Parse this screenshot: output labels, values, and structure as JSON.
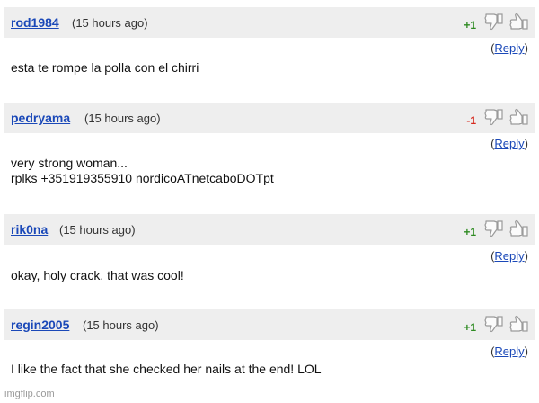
{
  "comments": [
    {
      "username": "rod1984",
      "time": "(15 hours ago)",
      "score": "+1",
      "reply_open": "(",
      "reply_label": "Reply",
      "reply_close": ")",
      "text": "esta te rompe la polla con el chirri"
    },
    {
      "username": "pedryama",
      "time": "(15 hours ago)",
      "score": "-1",
      "reply_open": "(",
      "reply_label": "Reply",
      "reply_close": ")",
      "text": "very strong woman...\nrplks +351919355910 nordicoATnetcaboDOTpt"
    },
    {
      "username": "rik0na",
      "time": "(15 hours ago)",
      "score": "+1",
      "reply_open": "(",
      "reply_label": "Reply",
      "reply_close": ")",
      "text": "okay, holy crack. that was cool!"
    },
    {
      "username": "regin2005",
      "time": "(15 hours ago)",
      "score": "+1",
      "reply_open": "(",
      "reply_label": "Reply",
      "reply_close": ")",
      "text": "I like the fact that she checked her nails at the end! LOL"
    }
  ],
  "watermark": "imgflip.com",
  "colors": {
    "username": "#1a48b8",
    "score_positive": "#2e8b22",
    "score_negative": "#d62a1f",
    "header_bg": "#eeeeee"
  },
  "icons": {
    "thumb_down": "thumbs-down-icon",
    "thumb_up": "thumbs-up-icon"
  }
}
